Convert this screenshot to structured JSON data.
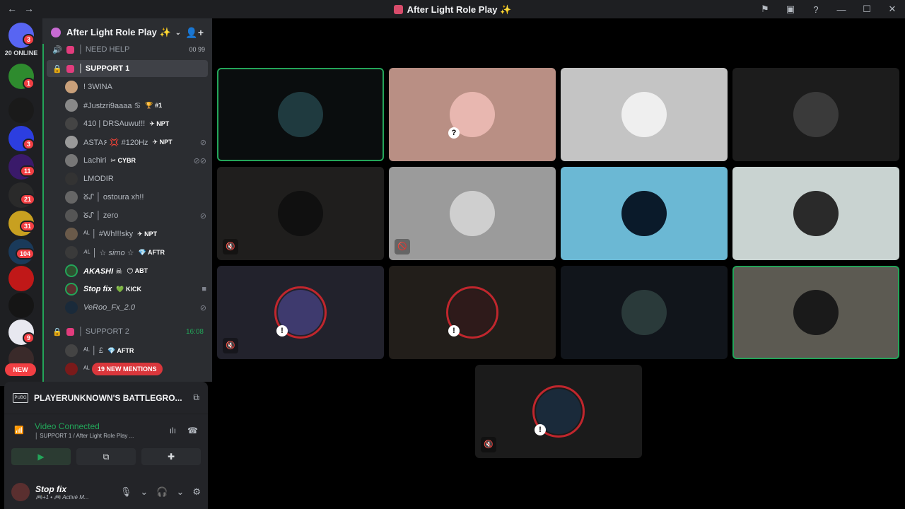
{
  "window": {
    "title": "After Light Role Play ✨",
    "nav_back": "←",
    "nav_forward": "→",
    "btn_inbox": "⚑",
    "btn_screen": "▣",
    "btn_help": "?",
    "btn_min": "—",
    "btn_max": "☐",
    "btn_close": "✕"
  },
  "guilds": {
    "online_label": "20 ONLINE",
    "badges": [
      "3",
      "1",
      "3",
      "11",
      "21",
      "31",
      "104",
      "9"
    ],
    "new_label": "NEW"
  },
  "server": {
    "name": "After Light Role Play ✨",
    "chevron": "⌄",
    "invite_icon": "👤+"
  },
  "channels": [
    {
      "name": "│ NEED HELP",
      "count": "00  99"
    },
    {
      "name": "│ SUPPORT 1"
    },
    {
      "name": "│ SUPPORT 2",
      "time": "16:08"
    }
  ],
  "support1_users": [
    {
      "name": "! 3WINA",
      "tag": "",
      "color": "#c9a07a"
    },
    {
      "name": "#Justzri9aaaa ♋",
      "tag": "🏆 #1",
      "color": "#888"
    },
    {
      "name": "410 | DRSAuwu!!!",
      "tag": "✈ NPT",
      "color": "#444"
    },
    {
      "name": "ASTA۶ 💢 #120Hz",
      "tag": "✈ NPT",
      "color": "#999"
    },
    {
      "name": "Lachiri",
      "tag": "✂ CYBR",
      "color": "#777"
    },
    {
      "name": "LMODIR",
      "tag": "",
      "color": "#333"
    },
    {
      "name": "ᘜᔑ │ ostoura xh!!",
      "tag": "",
      "color": "#666"
    },
    {
      "name": "ᘜᔑ │ zero",
      "tag": "",
      "color": "#555"
    },
    {
      "name": "ᴬᴸ │ #Wh!!!sky",
      "tag": "✈ NPT",
      "color": "#6a5a4a"
    },
    {
      "name": "ᴬᴸ │ ☆ simo ☆",
      "tag": "💎 AFTR",
      "color": "#3a3a3a"
    },
    {
      "name": "AKASHI ☠",
      "tag": "😶 ABT",
      "color": "#2f4f2f"
    },
    {
      "name": "Stop fix",
      "tag": "💚 KICK",
      "color": "#5a2f2f"
    },
    {
      "name": "VeRoo_Fx_2.0",
      "tag": "",
      "color": "#1a2a3a"
    }
  ],
  "support2_users": [
    {
      "name": "ᴬᴸ │ £",
      "tag": "💎 AFTR",
      "color": "#444"
    },
    {
      "name": "ᴬᴸ",
      "tag": "",
      "color": "#7a1a1a"
    }
  ],
  "mentions_label": "19 NEW MENTIONS",
  "activity": {
    "game_icon": "PUBG",
    "game_name": "PLAYERUNKNOWN'S BATTLEGRO...",
    "action_icon": "⧉"
  },
  "voice": {
    "signal_icon": "📶",
    "status": "Video Connected",
    "channel": "│ SUPPORT 1 / After Light Role Play ...",
    "noise_icon": "ılı",
    "disconnect_icon": "☎",
    "camera_icon": "▶",
    "share_icon": "⧉",
    "activities_icon": "✚"
  },
  "user": {
    "name": "Stop fix",
    "status": "🎮+1 • 🎮 Activé M...",
    "mic_icon": "🎙",
    "headset_icon": "🎧",
    "settings_icon": "⚙",
    "chev": "⌄"
  },
  "tiles": [
    {
      "bg": "#0a0d0e",
      "avatar": "#1f3a3f",
      "speaking": true,
      "mute": ""
    },
    {
      "bg": "#b98f84",
      "avatar": "#e8b7b0",
      "speaking": false,
      "mute": "",
      "alert": "?"
    },
    {
      "bg": "#c4c4c4",
      "avatar": "#efefef",
      "speaking": false,
      "mute": ""
    },
    {
      "bg": "#1c1c1c",
      "avatar": "#3a3a3a",
      "speaking": false,
      "mute": ""
    },
    {
      "bg": "#1f1e1d",
      "avatar": "#101010",
      "speaking": false,
      "mute": "🔇"
    },
    {
      "bg": "#9b9b9b",
      "avatar": "#cfcfcf",
      "speaking": false,
      "mute": "🚫"
    },
    {
      "bg": "#6bb8d4",
      "avatar": "#0a1a2a",
      "speaking": false,
      "mute": ""
    },
    {
      "bg": "#c9d3d1",
      "avatar": "#2a2a2a",
      "speaking": false,
      "mute": ""
    },
    {
      "bg": "#22222c",
      "avatar": "#3e3a6e",
      "speaking": false,
      "mute": "🔇",
      "alert": "!",
      "ring": true
    },
    {
      "bg": "#221e1a",
      "avatar": "#2e1a1a",
      "speaking": false,
      "mute": "",
      "alert": "!",
      "ring": true
    },
    {
      "bg": "#11151b",
      "avatar": "#2a3a3a",
      "speaking": false,
      "mute": ""
    },
    {
      "bg": "#5c5a52",
      "avatar": "#1a1a1a",
      "speaking": true,
      "mute": ""
    },
    {
      "bg": "#1b1b1b",
      "avatar": "#1a2a3a",
      "speaking": false,
      "mute": "🔇",
      "alert": "!",
      "ring": true
    }
  ]
}
